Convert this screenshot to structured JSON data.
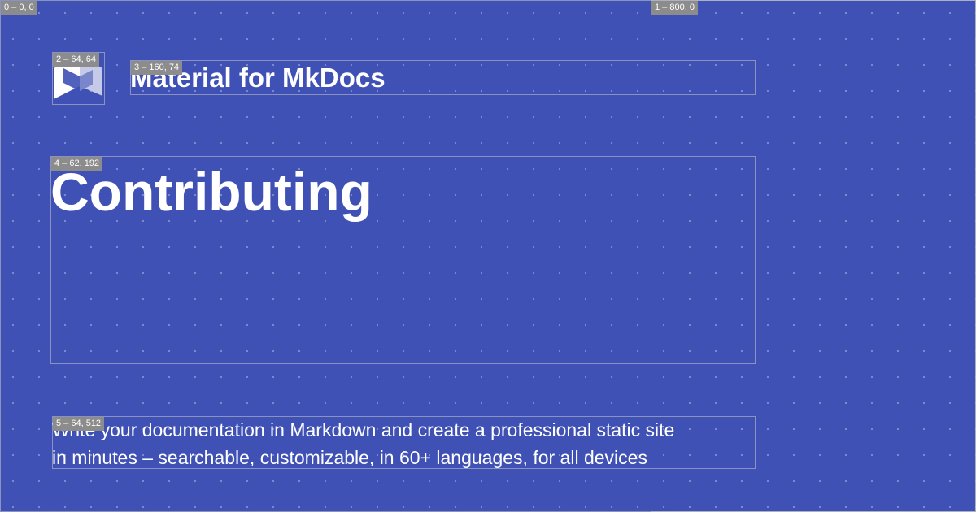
{
  "site": {
    "name": "Material for MkDocs",
    "logo_icon": "material-m-logo-icon"
  },
  "page": {
    "title": "Contributing",
    "description_lines": [
      "Write your documentation in Markdown and create a professional static site",
      "in minutes – searchable, customizable, in 60+ languages, for all devices"
    ]
  },
  "debug_regions": [
    "0 – 0, 0",
    "1 – 800, 0",
    "2 – 64, 64",
    "3 – 160, 74",
    "4 – 62, 192",
    "5 – 64, 512"
  ],
  "colors": {
    "background": "#3f51b5",
    "text": "#ffffff",
    "debug_label": "#8c8c8c"
  }
}
